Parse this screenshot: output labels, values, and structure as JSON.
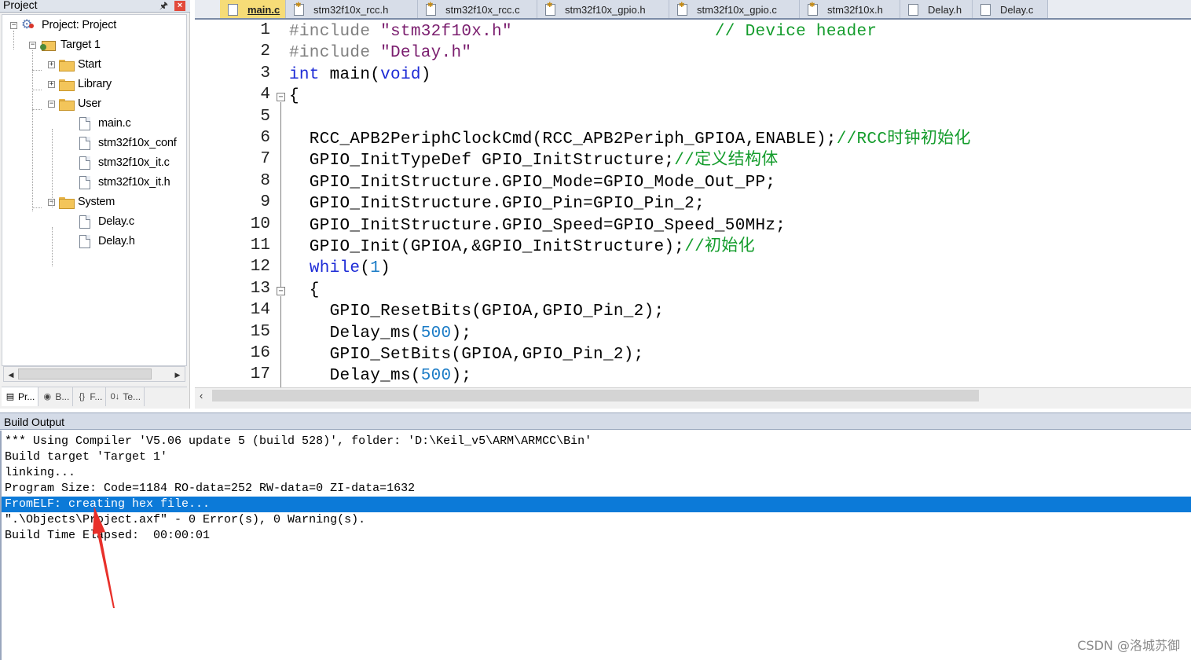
{
  "project_panel": {
    "title": "Project",
    "tree": [
      {
        "label": "Project: Project",
        "kind": "project",
        "level": 0,
        "expander": "−"
      },
      {
        "label": "Target 1",
        "kind": "target",
        "level": 1,
        "expander": "−"
      },
      {
        "label": "Start",
        "kind": "folder",
        "level": 2,
        "expander": "+"
      },
      {
        "label": "Library",
        "kind": "folder",
        "level": 2,
        "expander": "+"
      },
      {
        "label": "User",
        "kind": "folder",
        "level": 2,
        "expander": "−"
      },
      {
        "label": "main.c",
        "kind": "file",
        "level": 3
      },
      {
        "label": "stm32f10x_conf",
        "kind": "file",
        "level": 3
      },
      {
        "label": "stm32f10x_it.c",
        "kind": "file",
        "level": 3
      },
      {
        "label": "stm32f10x_it.h",
        "kind": "file",
        "level": 3
      },
      {
        "label": "System",
        "kind": "folder",
        "level": 2,
        "expander": "−"
      },
      {
        "label": "Delay.c",
        "kind": "file",
        "level": 3
      },
      {
        "label": "Delay.h",
        "kind": "file",
        "level": 3
      }
    ],
    "bottom_tabs": [
      {
        "label": "Pr...",
        "icon": "project-window-icon",
        "glyph": "▤"
      },
      {
        "label": "B...",
        "icon": "books-icon",
        "glyph": "◉"
      },
      {
        "label": "F...",
        "icon": "functions-icon",
        "glyph": "{}"
      },
      {
        "label": "Te...",
        "icon": "templates-icon",
        "glyph": "0↓"
      }
    ]
  },
  "editor": {
    "tabs": [
      {
        "label": "main.c",
        "active": true,
        "icon": "file-icon"
      },
      {
        "label": "stm32f10x_rcc.h",
        "active": false,
        "icon": "header-file-icon"
      },
      {
        "label": "stm32f10x_rcc.c",
        "active": false,
        "icon": "header-file-icon"
      },
      {
        "label": "stm32f10x_gpio.h",
        "active": false,
        "icon": "header-file-icon"
      },
      {
        "label": "stm32f10x_gpio.c",
        "active": false,
        "icon": "header-file-icon"
      },
      {
        "label": "stm32f10x.h",
        "active": false,
        "icon": "header-file-icon"
      },
      {
        "label": "Delay.h",
        "active": false,
        "icon": "file-icon"
      },
      {
        "label": "Delay.c",
        "active": false,
        "icon": "file-icon"
      }
    ],
    "lines": [
      {
        "n": "1",
        "code": [
          {
            "t": "#include ",
            "c": "pp"
          },
          {
            "t": "\"stm32f10x.h\"",
            "c": "str"
          },
          {
            "t": "                    ",
            "c": ""
          },
          {
            "t": "// Device header",
            "c": "cmt"
          }
        ]
      },
      {
        "n": "2",
        "code": [
          {
            "t": "#include ",
            "c": "pp"
          },
          {
            "t": "\"Delay.h\"",
            "c": "str"
          }
        ]
      },
      {
        "n": "3",
        "code": [
          {
            "t": "int",
            "c": "kw"
          },
          {
            "t": " main(",
            "c": ""
          },
          {
            "t": "void",
            "c": "kw"
          },
          {
            "t": ")",
            "c": ""
          }
        ]
      },
      {
        "n": "4",
        "code": [
          {
            "t": "{",
            "c": ""
          }
        ]
      },
      {
        "n": "5",
        "code": []
      },
      {
        "n": "6",
        "code": [
          {
            "t": "  RCC_APB2PeriphClockCmd(RCC_APB2Periph_GPIOA,ENABLE);",
            "c": ""
          },
          {
            "t": "//RCC时钟初始化",
            "c": "cmt"
          }
        ]
      },
      {
        "n": "7",
        "code": [
          {
            "t": "  GPIO_InitTypeDef GPIO_InitStructure;",
            "c": ""
          },
          {
            "t": "//定义结构体",
            "c": "cmt"
          }
        ]
      },
      {
        "n": "8",
        "code": [
          {
            "t": "  GPIO_InitStructure.GPIO_Mode=GPIO_Mode_Out_PP;",
            "c": ""
          }
        ]
      },
      {
        "n": "9",
        "code": [
          {
            "t": "  GPIO_InitStructure.GPIO_Pin=GPIO_Pin_2;",
            "c": ""
          }
        ]
      },
      {
        "n": "10",
        "code": [
          {
            "t": "  GPIO_InitStructure.GPIO_Speed=GPIO_Speed_50MHz;",
            "c": ""
          }
        ]
      },
      {
        "n": "11",
        "code": [
          {
            "t": "  GPIO_Init(GPIOA,&GPIO_InitStructure);",
            "c": ""
          },
          {
            "t": "//初始化",
            "c": "cmt"
          }
        ]
      },
      {
        "n": "12",
        "code": [
          {
            "t": "  ",
            "c": ""
          },
          {
            "t": "while",
            "c": "kw"
          },
          {
            "t": "(",
            "c": ""
          },
          {
            "t": "1",
            "c": "num"
          },
          {
            "t": ")",
            "c": ""
          }
        ]
      },
      {
        "n": "13",
        "code": [
          {
            "t": "  {",
            "c": ""
          }
        ]
      },
      {
        "n": "14",
        "code": [
          {
            "t": "    GPIO_ResetBits(GPIOA,GPIO_Pin_2);",
            "c": ""
          }
        ]
      },
      {
        "n": "15",
        "code": [
          {
            "t": "    Delay_ms(",
            "c": ""
          },
          {
            "t": "500",
            "c": "num"
          },
          {
            "t": ");",
            "c": ""
          }
        ]
      },
      {
        "n": "16",
        "code": [
          {
            "t": "    GPIO_SetBits(GPIOA,GPIO_Pin_2);",
            "c": ""
          }
        ]
      },
      {
        "n": "17",
        "code": [
          {
            "t": "    Delay_ms(",
            "c": ""
          },
          {
            "t": "500",
            "c": "num"
          },
          {
            "t": ");",
            "c": ""
          }
        ]
      }
    ]
  },
  "build_output": {
    "title": "Build Output",
    "lines": [
      {
        "text": "*** Using Compiler 'V5.06 update 5 (build 528)', folder: 'D:\\Keil_v5\\ARM\\ARMCC\\Bin'",
        "selected": false
      },
      {
        "text": "Build target 'Target 1'",
        "selected": false
      },
      {
        "text": "linking...",
        "selected": false
      },
      {
        "text": "Program Size: Code=1184 RO-data=252 RW-data=0 ZI-data=1632",
        "selected": false
      },
      {
        "text": "FromELF: creating hex file...",
        "selected": true
      },
      {
        "text": "\".\\Objects\\Project.axf\" - 0 Error(s), 0 Warning(s).",
        "selected": false
      },
      {
        "text": "Build Time Elapsed:  00:00:01",
        "selected": false
      }
    ]
  },
  "watermark": "CSDN @洛城苏御",
  "colors": {
    "keyword": "#1d2bd6",
    "string": "#7a1d6e",
    "comment": "#149c2c",
    "number": "#1a7bc6",
    "selection": "#0c7ad8",
    "active_tab": "#f6dc77"
  }
}
